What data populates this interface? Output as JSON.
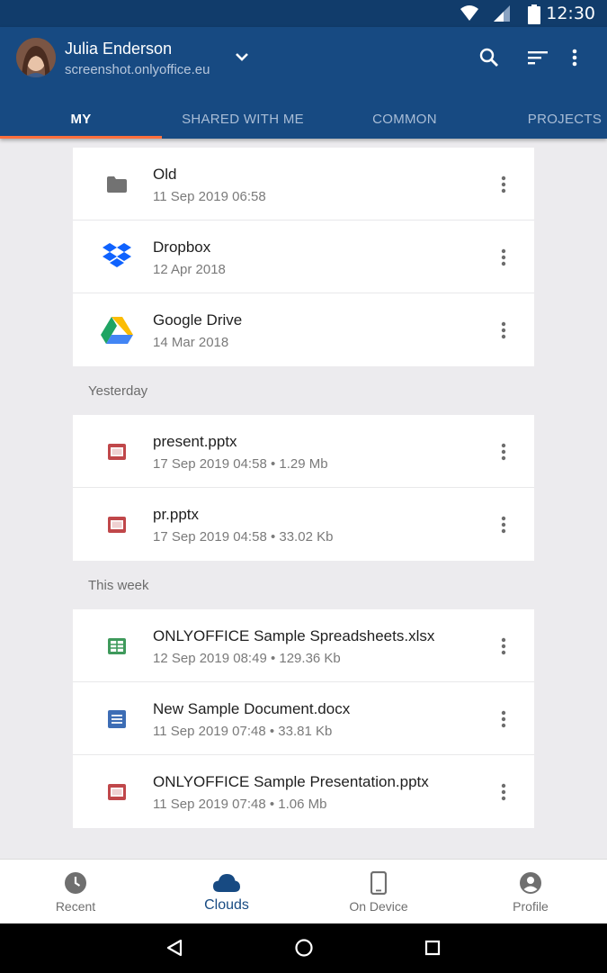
{
  "status_bar": {
    "time": "12:30",
    "icons": [
      "wifi-icon",
      "signal-icon",
      "battery-icon"
    ]
  },
  "account": {
    "name": "Julia Enderson",
    "portal": "screenshot.onlyoffice.eu"
  },
  "app_bar_icons": [
    "search-icon",
    "sort-icon",
    "more-vert-icon"
  ],
  "tabs": [
    {
      "label": "MY",
      "active": true
    },
    {
      "label": "SHARED WITH ME",
      "active": false
    },
    {
      "label": "COMMON",
      "active": false
    },
    {
      "label": "PROJECTS",
      "active": false
    }
  ],
  "folders": [
    {
      "title": "Old",
      "subtitle": "11 Sep 2019 06:58",
      "icon": "folder-icon"
    },
    {
      "title": "Dropbox",
      "subtitle": "12 Apr 2018",
      "icon": "dropbox-icon"
    },
    {
      "title": "Google Drive",
      "subtitle": "14 Mar 2018",
      "icon": "google-drive-icon"
    }
  ],
  "sections": [
    {
      "label": "Yesterday",
      "items": [
        {
          "title": "present.pptx",
          "subtitle": "17 Sep 2019 04:58 • 1.29 Mb",
          "icon": "presentation-file-icon"
        },
        {
          "title": "pr.pptx",
          "subtitle": "17 Sep 2019 04:58 • 33.02 Kb",
          "icon": "presentation-file-icon"
        }
      ]
    },
    {
      "label": "This week",
      "items": [
        {
          "title": "ONLYOFFICE Sample Spreadsheets.xlsx",
          "subtitle": "12 Sep 2019 08:49 • 129.36 Kb",
          "icon": "spreadsheet-file-icon"
        },
        {
          "title": "New Sample Document.docx",
          "subtitle": "11 Sep 2019 07:48 • 33.81 Kb",
          "icon": "document-file-icon"
        },
        {
          "title": "ONLYOFFICE Sample Presentation.pptx",
          "subtitle": "11 Sep 2019 07:48 • 1.06 Mb",
          "icon": "presentation-file-icon"
        }
      ]
    }
  ],
  "bottom_nav": [
    {
      "label": "Recent",
      "icon": "clock-icon",
      "active": false
    },
    {
      "label": "Clouds",
      "icon": "cloud-icon",
      "active": true
    },
    {
      "label": "On Device",
      "icon": "phone-icon",
      "active": false
    },
    {
      "label": "Profile",
      "icon": "account-circle-icon",
      "active": false
    }
  ],
  "system_nav_icons": [
    "back-icon",
    "home-icon",
    "recents-icon"
  ],
  "colors": {
    "app_bar": "#174a82",
    "status_bar": "#113c6b",
    "tab_indicator": "#ff6f3d",
    "presentation": "#c0474a",
    "spreadsheet": "#3f9a5c",
    "document": "#3d6db5"
  }
}
